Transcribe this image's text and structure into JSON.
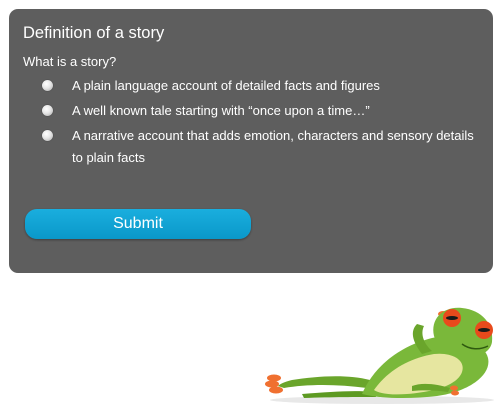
{
  "quiz": {
    "title": "Definition of a story",
    "question": "What is a story?",
    "options": [
      {
        "label": "A plain language account of detailed facts and figures",
        "selected": false
      },
      {
        "label": "A well known tale starting with “once upon a time…”",
        "selected": false
      },
      {
        "label": "A narrative account that adds emotion, characters and sensory details to plain facts",
        "selected": false
      }
    ],
    "submit_label": "Submit"
  },
  "colors": {
    "card_background": "#5e5e5e",
    "button_background": "#12a6d6",
    "text": "#ffffff"
  },
  "decoration": {
    "image": "frog-illustration"
  }
}
